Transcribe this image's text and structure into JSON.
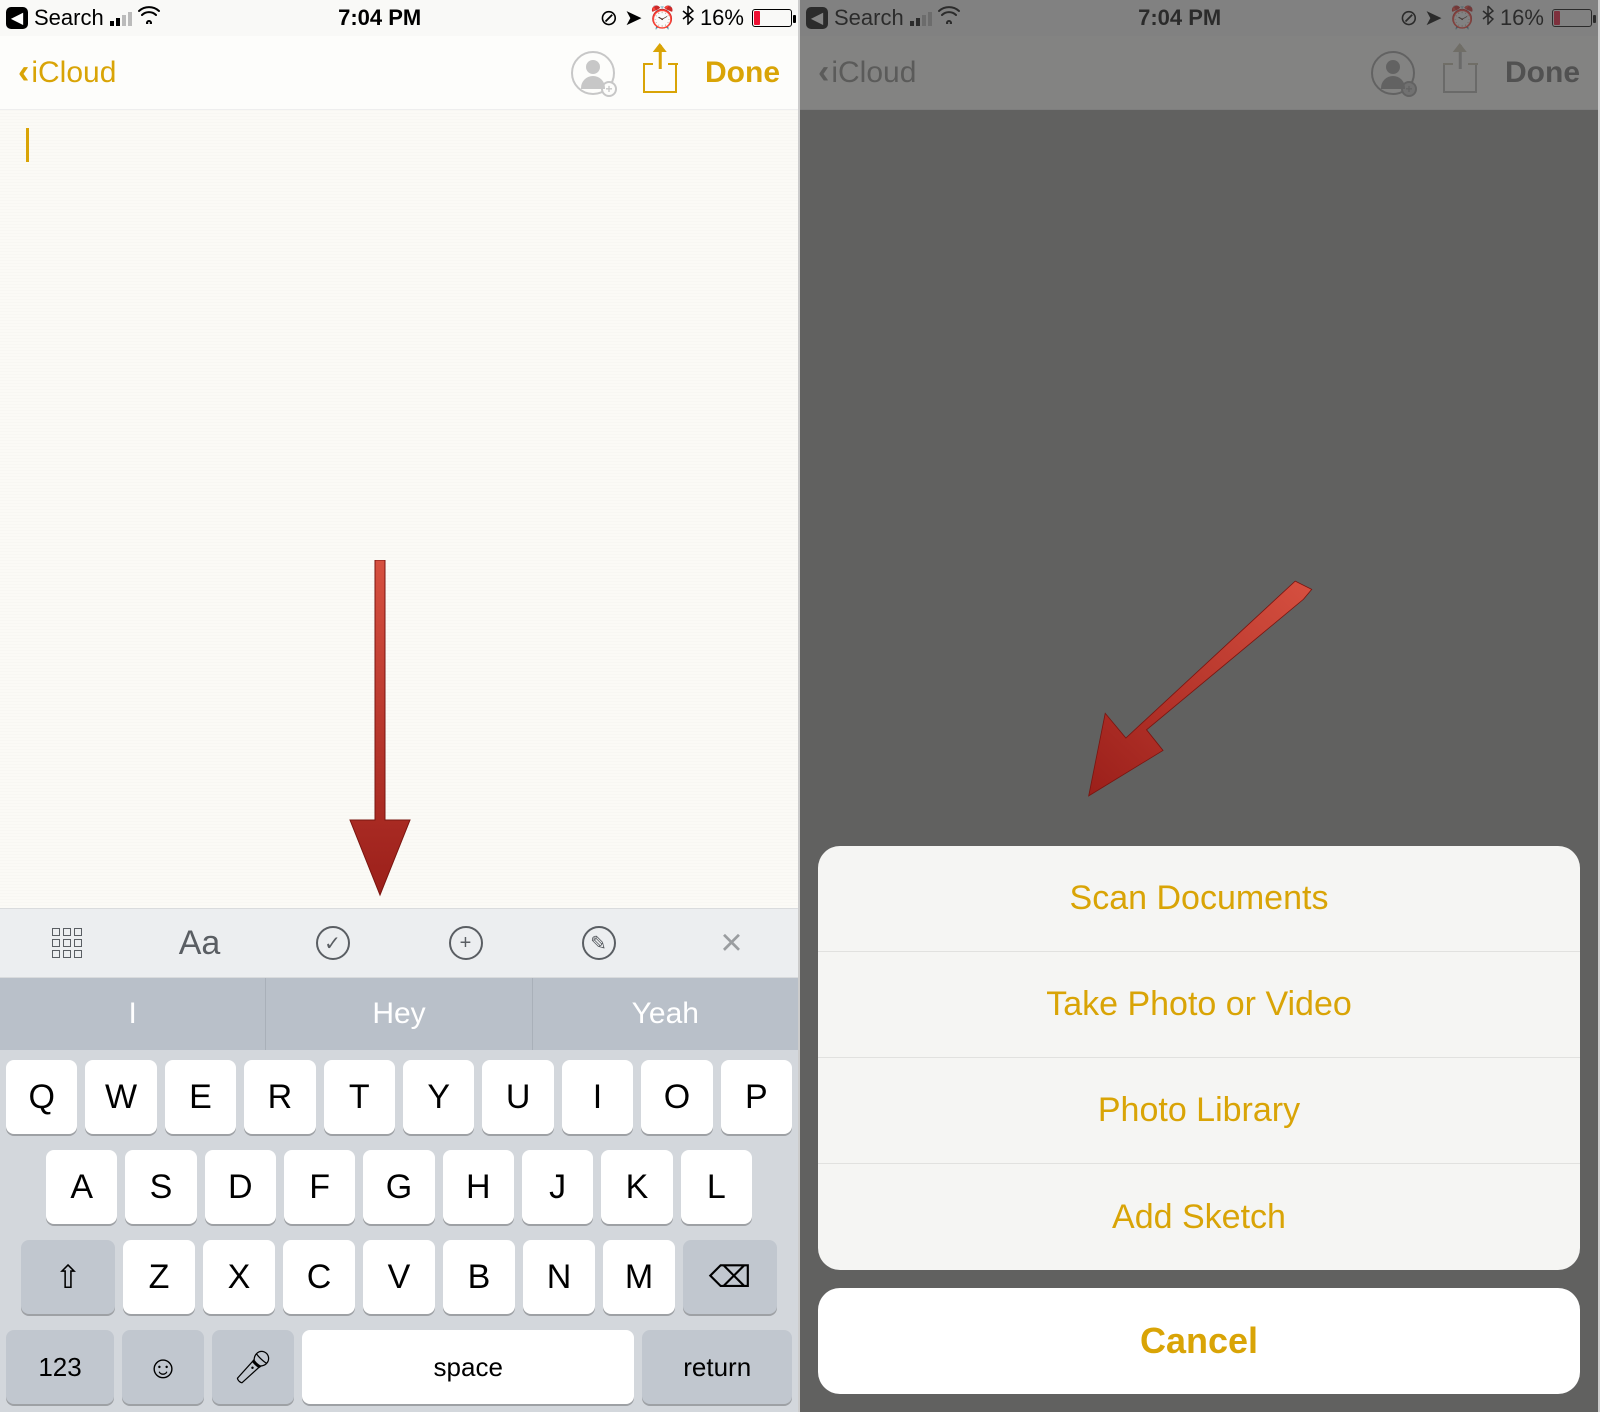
{
  "status": {
    "back_label": "Search",
    "time": "7:04 PM",
    "battery_pct": "16%"
  },
  "nav": {
    "back_label": "iCloud",
    "done_label": "Done"
  },
  "format_bar": {
    "text_style_label": "Aa"
  },
  "suggestions": [
    "I",
    "Hey",
    "Yeah"
  ],
  "keyboard": {
    "row1": [
      "Q",
      "W",
      "E",
      "R",
      "T",
      "Y",
      "U",
      "I",
      "O",
      "P"
    ],
    "row2": [
      "A",
      "S",
      "D",
      "F",
      "G",
      "H",
      "J",
      "K",
      "L"
    ],
    "row3": [
      "Z",
      "X",
      "C",
      "V",
      "B",
      "N",
      "M"
    ],
    "num_label": "123",
    "space_label": "space",
    "return_label": "return"
  },
  "action_sheet": {
    "items": [
      "Scan Documents",
      "Take Photo or Video",
      "Photo Library",
      "Add Sketch"
    ],
    "cancel": "Cancel"
  },
  "colors": {
    "accent": "#d9a406"
  }
}
